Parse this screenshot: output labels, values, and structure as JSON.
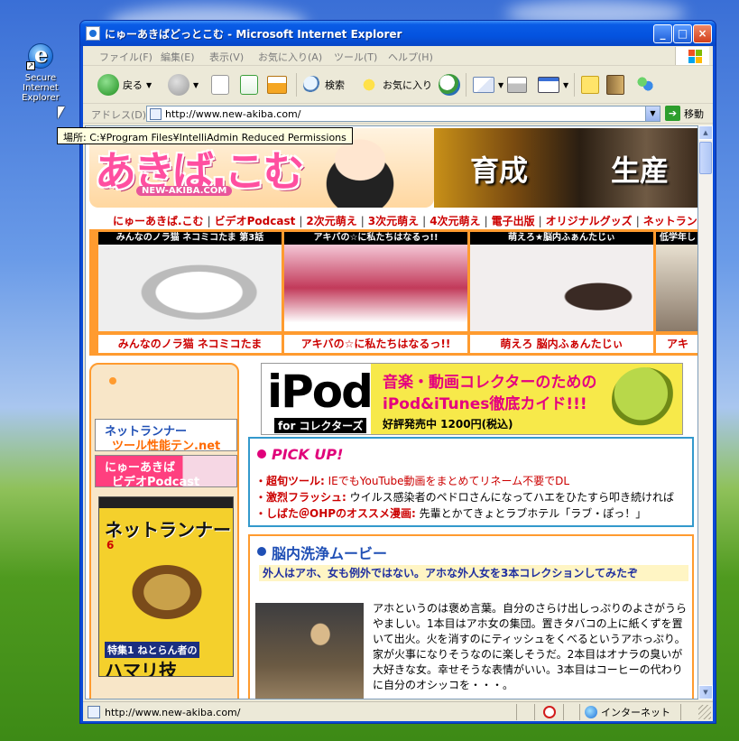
{
  "desktop": {
    "icon_label": "Secure Internet Explorer"
  },
  "tooltip": {
    "text": "場所: C:¥Program Files¥IntelliAdmin Reduced Permissions"
  },
  "window": {
    "title": "にゅーあきばどっとこむ - Microsoft Internet Explorer",
    "min_label": "_",
    "max_label": "□",
    "close_label": "×"
  },
  "menu": {
    "items": [
      "ファイル(F)",
      "編集(E)",
      "表示(V)",
      "お気に入り(A)",
      "ツール(T)",
      "ヘルプ(H)"
    ]
  },
  "toolbar": {
    "back_label": "戻る",
    "search_label": "検索",
    "favorites_label": "お気に入り"
  },
  "address": {
    "label": "アドレス(D)",
    "url": "http://www.new-akiba.com/",
    "go_label": "移動"
  },
  "page": {
    "logo_text": "あきば.こむ",
    "logo_sub": "NEW-AKIBA.COM",
    "banner_word1": "育成",
    "banner_word2": "生産",
    "nav_links": [
      "にゅーあきば.こむ",
      "ビデオPodcast",
      "2次元萌え",
      "3次元萌え",
      "4次元萌え",
      "電子出版",
      "オリジナルグッズ",
      "ネットラン"
    ],
    "thumbs": [
      {
        "caption": "みんなのノラ猫 ネコミコたま 第3話",
        "title": "みんなのノラ猫 ネコミコたま"
      },
      {
        "caption": "アキバの☆に私たちはなるっ!!",
        "title": "アキバの☆に私たちはなるっ!!"
      },
      {
        "caption": "萌えろ★脳内ふぁんたじぃ",
        "title": "萌えろ 脳内ふぁんたじぃ"
      },
      {
        "caption": "低学年し",
        "title": "アキ"
      }
    ],
    "side_banner1_line1": "ネットランナー",
    "side_banner1_line2": "ツール性能テン.net",
    "side_banner2_line1": "にゅーあきば",
    "side_banner2_line2": "ビデオPodcast",
    "mag_title": "ネットランナー",
    "mag_issue": "6",
    "mag_feature": "特集1 ねとらん者の",
    "mag_headline": "ハマリ技",
    "ipod_logo": "iPod",
    "ipod_for": "for コレクターズ",
    "ipod_line1": "音楽・動画コレクターのための",
    "ipod_line2": "iPod&iTunes徹底カイド!!!",
    "ipod_line3": "好評発売中 1200円(税込)",
    "pickup_title": "PICK UP!",
    "pickups": [
      {
        "bold": "・超旬ツール:",
        "text": " IEでもYouTube動画をまとめてリネーム不要でDL"
      },
      {
        "bold": "・激烈フラッシュ:",
        "text": " ウイルス感染者のペドロさんになってハエをひたすら叩き続ければ"
      },
      {
        "bold": "・しばた＠OHPのオススメ漫画:",
        "text": " 先輩とかてきょとラブホテル「ラブ・ぽっ！」"
      }
    ],
    "noushin_title": "脳内洗浄ムービー",
    "noushin_sub": "外人はアホ、女も例外ではない。アホな外人女を3本コレクションしてみたぞ",
    "noushin_body": "アホというのは褒め言葉。自分のさらけ出しっぷりのよさがうらやましい。1本目はアホ女の集団。置きタバコの上に紙くずを置いて出火。火を消すのにティッシュをくべるというアホっぷり。家が火事になりそうなのに楽しそうだ。2本目はオナラの臭いが大好きな女。幸せそうな表情がいい。3本目はコーヒーの代わりに自分のオシッコを・・・。"
  },
  "statusbar": {
    "url": "http://www.new-akiba.com/",
    "zone": "インターネット"
  },
  "colors": {
    "xp_blue": "#0a4bd6",
    "accent_orange": "#ff9b2f",
    "link_red": "#cc0000",
    "pickup_border": "#3399cc"
  }
}
